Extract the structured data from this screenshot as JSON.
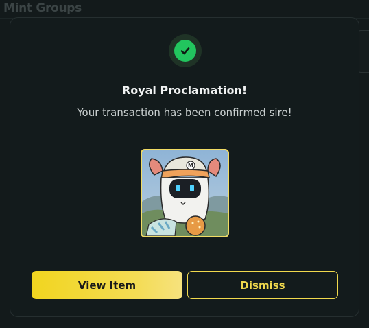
{
  "background": {
    "title": "Mint Groups"
  },
  "modal": {
    "icon": "check-circle-icon",
    "title": "Royal Proclamation!",
    "message": "Your transaction has been confirmed sire!",
    "nft_image": "robot-bear-nft-image",
    "primary_button": "View Item",
    "secondary_button": "Dismiss"
  },
  "colors": {
    "accent": "#f2d43a",
    "success": "#22c55e",
    "background": "#131a1b"
  }
}
